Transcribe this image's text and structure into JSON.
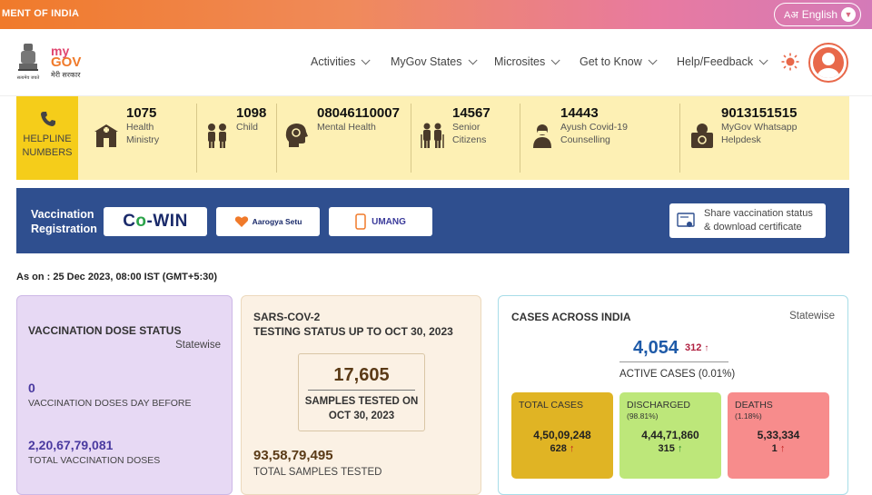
{
  "topbar": {
    "gov_text": "MENT OF INDIA",
    "language": "English",
    "lang_glyph": "Aअ"
  },
  "header": {
    "emblem_caption": "सत्यमेव जयते",
    "logo": {
      "my": "my",
      "gov": "GOV",
      "hindi": "मेरी सरकार"
    },
    "nav": [
      "Activities",
      "MyGov States",
      "Microsites",
      "Get to Know",
      "Help/Feedback"
    ]
  },
  "helpline": {
    "badge": "HELPLINE NUMBERS",
    "items": [
      {
        "number": "1075",
        "label1": "Health",
        "label2": "Ministry",
        "icon": "hospital-icon"
      },
      {
        "number": "1098",
        "label1": "Child",
        "label2": "",
        "icon": "children-icon"
      },
      {
        "number": "08046110007",
        "label1": "Mental Health",
        "label2": "",
        "icon": "mental-health-icon"
      },
      {
        "number": "14567",
        "label1": "Senior",
        "label2": "Citizens",
        "icon": "senior-citizens-icon"
      },
      {
        "number": "14443",
        "label1": "Ayush Covid-19",
        "label2": "Counselling",
        "icon": "counselling-icon"
      },
      {
        "number": "9013151515",
        "label1": "MyGov Whatsapp",
        "label2": "Helpdesk",
        "icon": "whatsapp-helpdesk-icon"
      }
    ]
  },
  "vaccination": {
    "title_line1": "Vaccination",
    "title_line2": "Registration",
    "cowin": {
      "c": "C",
      "o": "o",
      "rest": "-WIN"
    },
    "arogya": "Aarogya Setu",
    "umang": "UMANG",
    "share_line1": "Share vaccination status",
    "share_line2": "& download certificate"
  },
  "as_on": "As on : 25 Dec 2023, 08:00 IST (GMT+5:30)",
  "dose_card": {
    "title": "VACCINATION DOSE STATUS",
    "statewise": "Statewise",
    "day_before_value": "0",
    "day_before_label": "VACCINATION DOSES DAY BEFORE",
    "total_value": "2,20,67,79,081",
    "total_label": "TOTAL VACCINATION DOSES"
  },
  "testing_card": {
    "title_line1": "SARS-COV-2",
    "title_line2": "TESTING STATUS UP TO OCT 30, 2023",
    "samples_value": "17,605",
    "samples_label_line1": "SAMPLES TESTED ON",
    "samples_label_line2": "OCT 30, 2023",
    "total_value": "93,58,79,495",
    "total_label": "TOTAL SAMPLES TESTED"
  },
  "cases_card": {
    "title": "CASES ACROSS INDIA",
    "statewise": "Statewise",
    "active_value": "4,054",
    "active_delta": "312",
    "active_label": "ACTIVE CASES (0.01%)",
    "arrow": "↑",
    "total": {
      "label": "TOTAL CASES",
      "value": "4,50,09,248",
      "delta": "628"
    },
    "discharged": {
      "label": "DISCHARGED",
      "pct": "(98.81%)",
      "value": "4,44,71,860",
      "delta": "315"
    },
    "deaths": {
      "label": "DEATHS",
      "pct": "(1.18%)",
      "value": "5,33,334",
      "delta": "1"
    }
  },
  "colors": {
    "helpline_bg": "#fdf0b4",
    "badge_bg": "#f5cd1a",
    "vaccination_bar": "#2f4f8f",
    "active_blue": "#1e5aa8"
  }
}
